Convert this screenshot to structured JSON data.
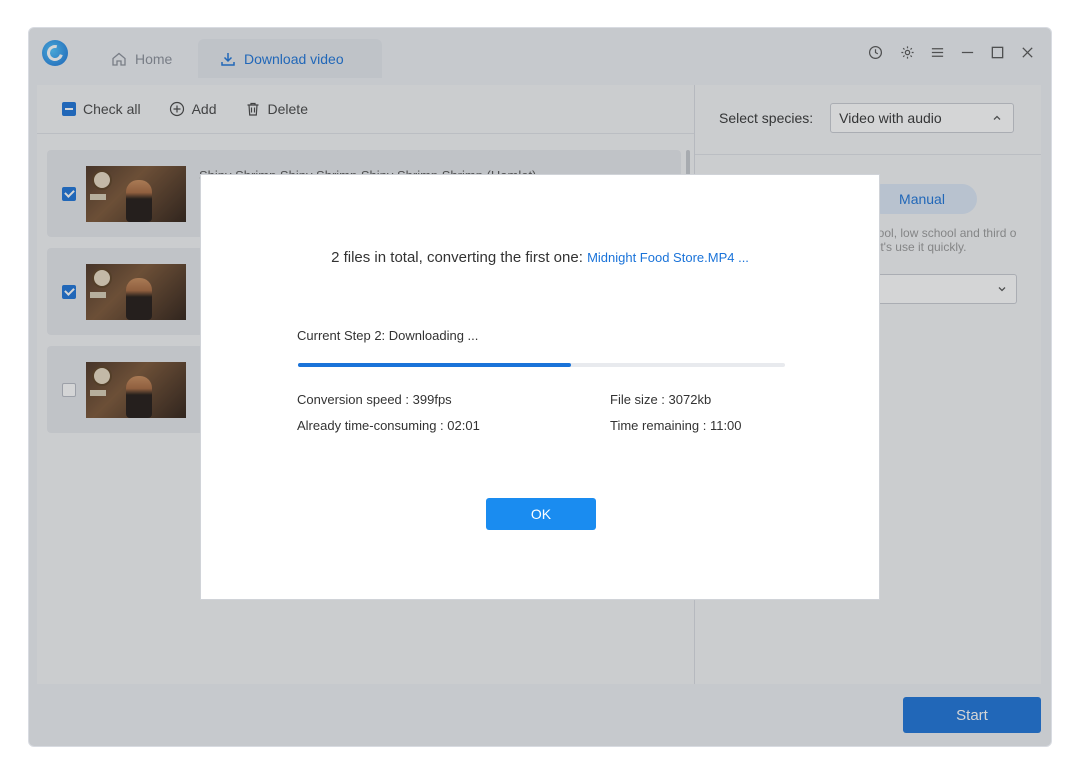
{
  "tabs": {
    "home": "Home",
    "download": "Download video"
  },
  "toolbar": {
    "check_all": "Check all",
    "add": "Add",
    "delete": "Delete"
  },
  "files": [
    {
      "title": "Shiny Shrimp Shiny Shrimp Shiny Shrimp Shrimp (Hamlet)",
      "checked": true
    },
    {
      "title": "",
      "checked": true
    },
    {
      "title": "",
      "checked": false
    }
  ],
  "settings": {
    "species_label": "Select species:",
    "species_value": "Video with audio",
    "mode_manual": "Manual",
    "note": "hool, low school and third o let's use it quickly."
  },
  "start_label": "Start",
  "dialog": {
    "summary": "2 files in total, converting the first one:",
    "filename": "Midnight Food Store.MP4 ...",
    "step": "Current Step 2: Downloading ...",
    "progress": 0.56,
    "speed_label": "Conversion speed :",
    "speed_value": "399fps",
    "size_label": "File size :",
    "size_value": "3072kb",
    "elapsed_label": "Already time-consuming :",
    "elapsed_value": "02:01",
    "remaining_label": "Time remaining :",
    "remaining_value": "11:00",
    "ok": "OK"
  },
  "colors": {
    "accent": "#1a73d9",
    "ok_button": "#1a8cf0"
  }
}
